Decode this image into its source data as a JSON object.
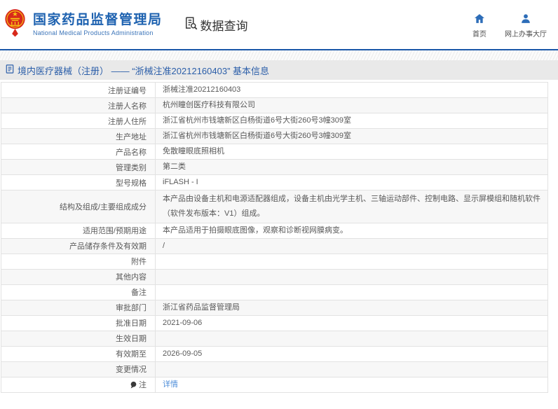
{
  "header": {
    "logo_title": "国家药品监督管理局",
    "logo_subtitle": "National Medical Products Administration",
    "section_label": "数据查询",
    "nav_items": [
      {
        "label": "首页",
        "icon": "home-icon"
      },
      {
        "label": "网上办事大厅",
        "icon": "person-icon"
      }
    ]
  },
  "breadcrumb": {
    "text": "境内医疗器械（注册） —— “浙械注准20212160403” 基本信息"
  },
  "table": {
    "rows": [
      {
        "label": "注册证编号",
        "value": "浙械注准20212160403"
      },
      {
        "label": "注册人名称",
        "value": "杭州瞳创医疗科技有限公司"
      },
      {
        "label": "注册人住所",
        "value": "浙江省杭州市钱塘新区白杨街道6号大街260号3幢309室"
      },
      {
        "label": "生产地址",
        "value": "浙江省杭州市钱塘新区白杨街道6号大街260号3幢309室"
      },
      {
        "label": "产品名称",
        "value": "免散瞳眼底照相机"
      },
      {
        "label": "管理类别",
        "value": "第二类"
      },
      {
        "label": "型号规格",
        "value": "iFLASH - I"
      },
      {
        "label": "结构及组成/主要组成成分",
        "value": "本产品由设备主机和电源适配器组成，设备主机由光学主机、三轴运动部件、控制电路、显示屏模组和随机软件（软件发布版本：V1）组成。",
        "tall": true
      },
      {
        "label": "适用范围/预期用途",
        "value": "本产品适用于拍摄眼底图像，观察和诊断视网膜病变。"
      },
      {
        "label": "产品储存条件及有效期",
        "value": "/"
      },
      {
        "label": "附件",
        "value": ""
      },
      {
        "label": "其他内容",
        "value": ""
      },
      {
        "label": "备注",
        "value": ""
      },
      {
        "label": "审批部门",
        "value": "浙江省药品监督管理局"
      },
      {
        "label": "批准日期",
        "value": "2021-09-06"
      },
      {
        "label": "生效日期",
        "value": ""
      },
      {
        "label": "有效期至",
        "value": "2026-09-05"
      },
      {
        "label": "变更情况",
        "value": ""
      },
      {
        "label": "注",
        "value": "详情",
        "link": true,
        "icon": "note-icon"
      }
    ]
  },
  "colors": {
    "brand_blue": "#1e62b0",
    "nav_icon_blue": "#2d6db8",
    "breadcrumb_text": "#2b5ea9",
    "link_blue": "#4e8ed9",
    "header_border": "#1a57a8",
    "row_alt": "#f7f7f7",
    "table_border": "#d4d4d4",
    "text": "#595959"
  }
}
